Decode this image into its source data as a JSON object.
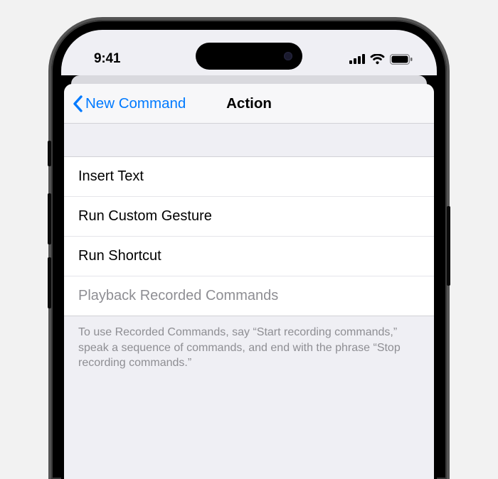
{
  "status": {
    "time": "9:41"
  },
  "nav": {
    "back_label": "New Command",
    "title": "Action"
  },
  "actions": [
    {
      "label": "Insert Text",
      "enabled": true
    },
    {
      "label": "Run Custom Gesture",
      "enabled": true
    },
    {
      "label": "Run Shortcut",
      "enabled": true
    },
    {
      "label": "Playback Recorded Commands",
      "enabled": false
    }
  ],
  "footer": "To use Recorded Commands, say “Start recording commands,” speak a sequence of commands, and end with the phrase “Stop recording commands.”"
}
